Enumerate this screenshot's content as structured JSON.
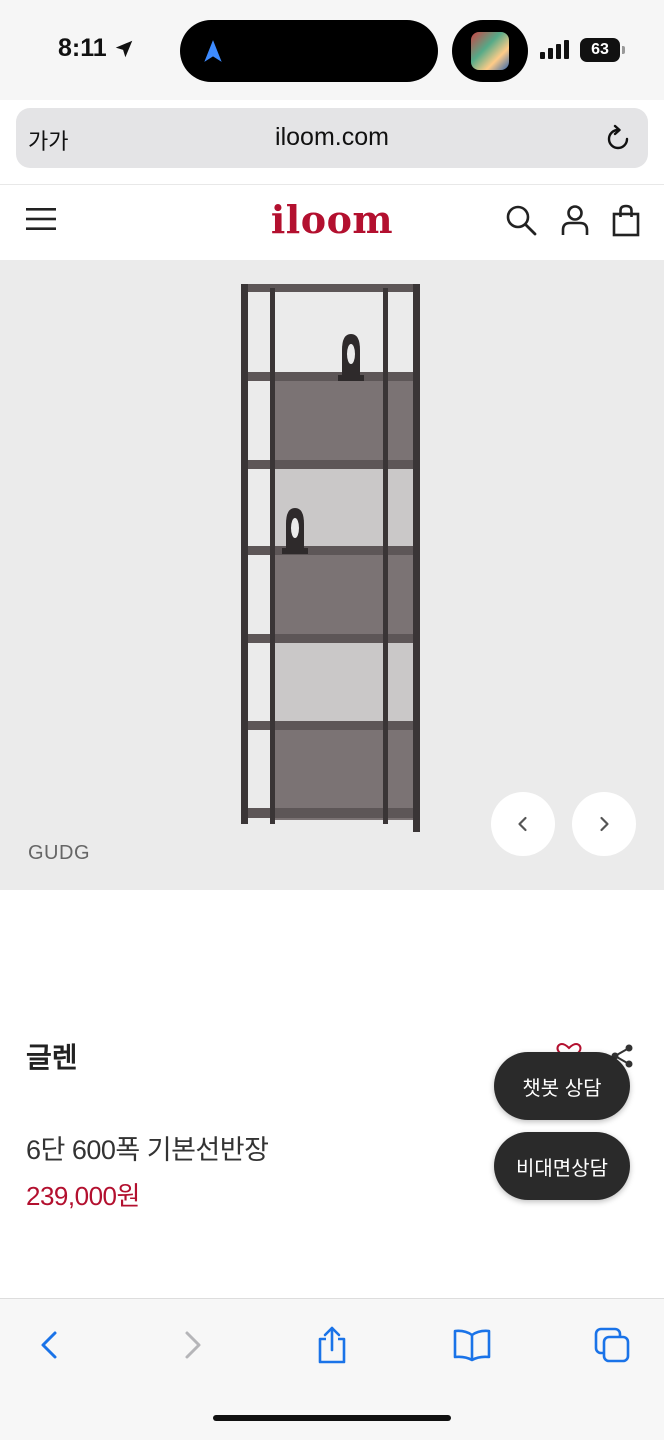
{
  "status_bar": {
    "time": "8:11",
    "battery": "63"
  },
  "url_bar": {
    "text_size_label": "가가",
    "url": "iloom.com"
  },
  "header": {
    "logo": "iloom"
  },
  "gallery": {
    "color_code": "GUDG"
  },
  "product": {
    "name": "글렌",
    "description": "6단 600폭 기본선반장",
    "price": "239,000원"
  },
  "floating": {
    "chatbot_label": "챗봇 상담",
    "contact_label": "비대면상담"
  },
  "colors": {
    "brand": "#b3102f",
    "ios_blue": "#1a73e8",
    "button_dark": "#2a2a2a"
  }
}
